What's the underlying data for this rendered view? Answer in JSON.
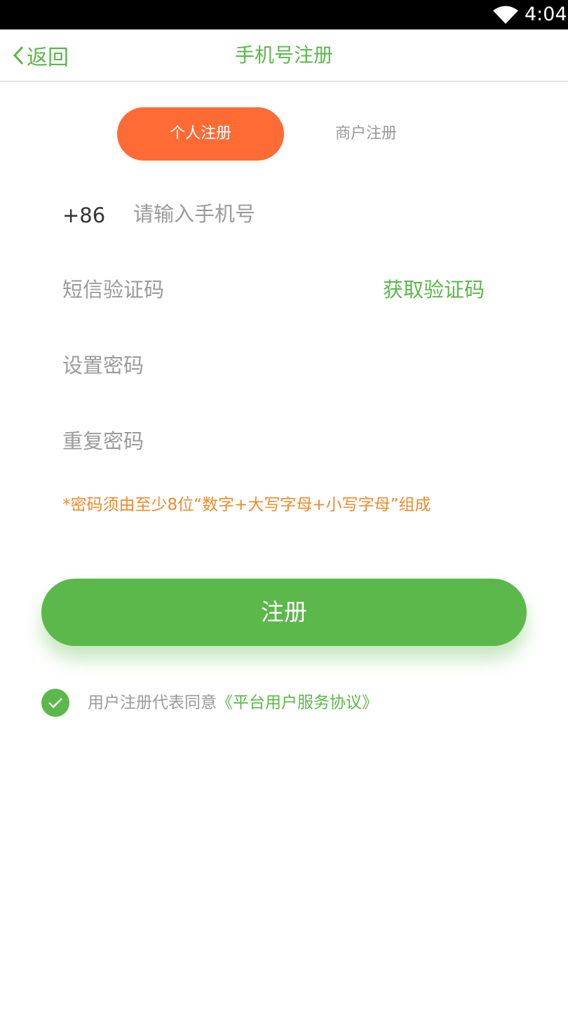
{
  "status_bar": {
    "time": "4:04",
    "wifi_icon": "wifi-icon"
  },
  "nav": {
    "back_label": "返回",
    "title": "手机号注册",
    "back_icon": "chevron-left-icon"
  },
  "tabs": [
    {
      "label": "个人注册",
      "active": true
    },
    {
      "label": "商户注册",
      "active": false
    }
  ],
  "form": {
    "country_code": "+86",
    "phone_placeholder": "请输入手机号",
    "phone_value": "",
    "sms_placeholder": "短信验证码",
    "sms_value": "",
    "get_code_label": "获取验证码",
    "password_placeholder": "设置密码",
    "password_value": "",
    "confirm_placeholder": "重复密码",
    "confirm_value": "",
    "hint": "*密码须由至少8位“数字+大写字母+小写字母”组成"
  },
  "register_label": "注册",
  "agreement": {
    "checked": true,
    "prefix": "用户注册代表同意",
    "link": "《平台用户服务协议》"
  },
  "colors": {
    "accent_green": "#5bb84a",
    "accent_orange": "#ff6b35",
    "hint_orange": "#f08a2c"
  }
}
